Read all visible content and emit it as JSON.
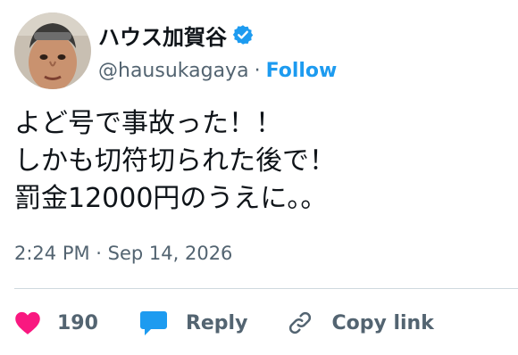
{
  "author": {
    "display_name": "ハウス加賀谷",
    "handle": "@hausukagaya",
    "separator": "·",
    "follow_label": "Follow",
    "verified": true
  },
  "tweet": {
    "lines": [
      "よど号で事故った！！",
      "しかも切符切られた後で！",
      "罰金12000円のうえに。。"
    ],
    "timestamp": "2:24 PM · Sep 14, 2026"
  },
  "actions": {
    "like_count": "190",
    "reply_label": "Reply",
    "copy_link_label": "Copy link"
  },
  "icons": {
    "verified": "verified-badge-icon",
    "like": "heart-icon",
    "reply": "speech-bubble-icon",
    "copy_link": "link-icon"
  },
  "colors": {
    "accent": "#1d9bf0",
    "like": "#f91880",
    "text_primary": "#0f1419",
    "text_secondary": "#536471",
    "divider": "#cfd9de"
  }
}
